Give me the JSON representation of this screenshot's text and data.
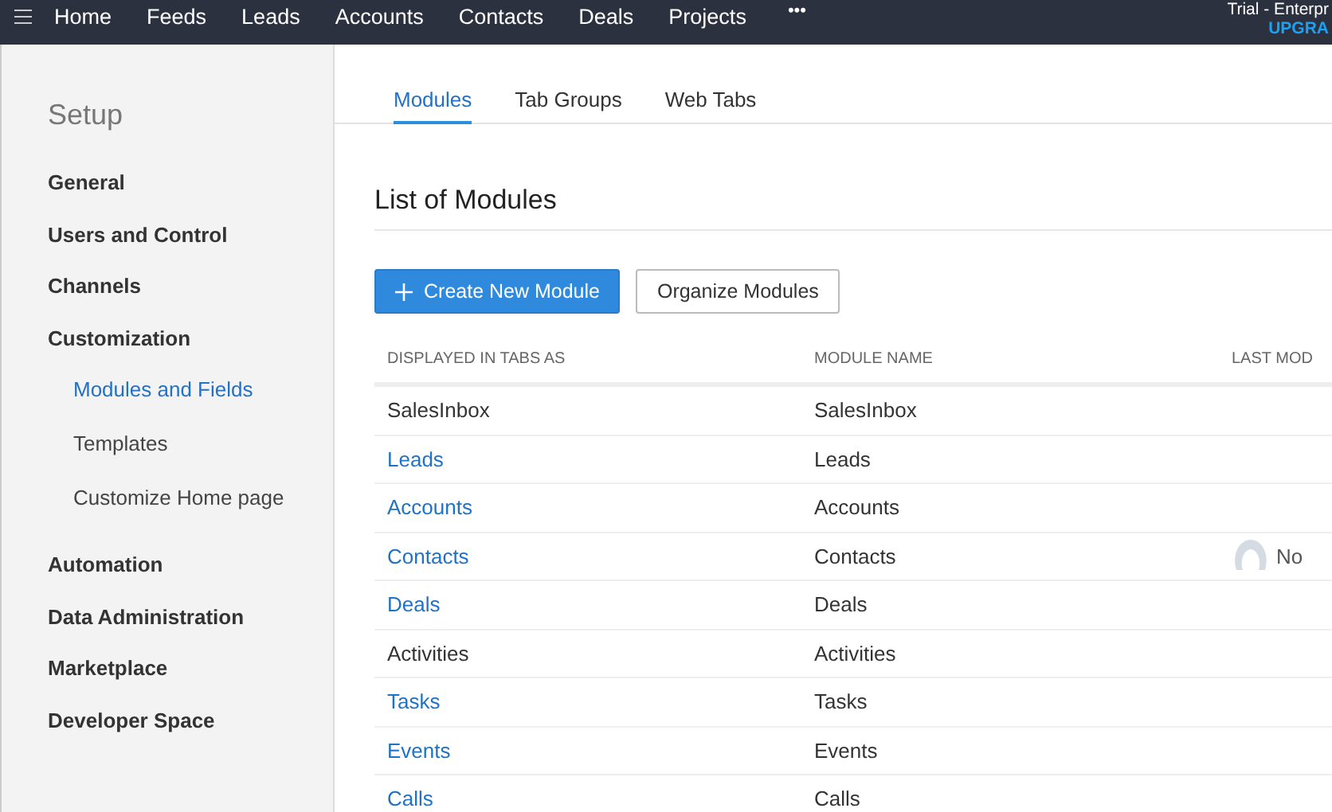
{
  "top_nav": {
    "items": [
      "Home",
      "Feeds",
      "Leads",
      "Accounts",
      "Contacts",
      "Deals",
      "Projects"
    ],
    "more": "•••",
    "account": "Trial - Enterpr",
    "upgrade": "UPGRA"
  },
  "sidebar": {
    "title": "Setup",
    "items": [
      {
        "label": "General",
        "selected": false
      },
      {
        "label": "Users and Control",
        "selected": false
      },
      {
        "label": "Channels",
        "selected": false
      },
      {
        "label": "Customization",
        "selected": false,
        "children": [
          {
            "label": "Modules and Fields",
            "selected": true
          },
          {
            "label": "Templates",
            "selected": false
          },
          {
            "label": "Customize Home page",
            "selected": false
          }
        ]
      },
      {
        "label": "Automation",
        "selected": false
      },
      {
        "label": "Data Administration",
        "selected": false
      },
      {
        "label": "Marketplace",
        "selected": false
      },
      {
        "label": "Developer Space",
        "selected": false
      }
    ]
  },
  "tabs": [
    {
      "label": "Modules",
      "selected": true
    },
    {
      "label": "Tab Groups",
      "selected": false
    },
    {
      "label": "Web Tabs",
      "selected": false
    }
  ],
  "heading": "List of Modules",
  "buttons": [
    {
      "label": "Create New Module",
      "kind": "primary"
    },
    {
      "label": "Organize Modules",
      "kind": "secondary"
    }
  ],
  "table": {
    "columns": [
      "DISPLAYED IN TABS AS",
      "MODULE NAME",
      "LAST MOD"
    ],
    "rows": [
      {
        "kind": "plain",
        "tab": "SalesInbox",
        "module": "SalesInbox"
      },
      {
        "kind": "link",
        "tab": "Leads",
        "module": "Leads"
      },
      {
        "kind": "link",
        "tab": "Accounts",
        "module": "Accounts"
      },
      {
        "kind": "link",
        "tab": "Contacts",
        "module": "Contacts",
        "last_modified": "No"
      },
      {
        "kind": "link",
        "tab": "Deals",
        "module": "Deals"
      },
      {
        "kind": "plain",
        "tab": "Activities",
        "module": "Activities"
      },
      {
        "kind": "link",
        "tab": "Tasks",
        "module": "Tasks"
      },
      {
        "kind": "link",
        "tab": "Events",
        "module": "Events"
      },
      {
        "kind": "link",
        "tab": "Calls",
        "module": "Calls"
      }
    ]
  }
}
